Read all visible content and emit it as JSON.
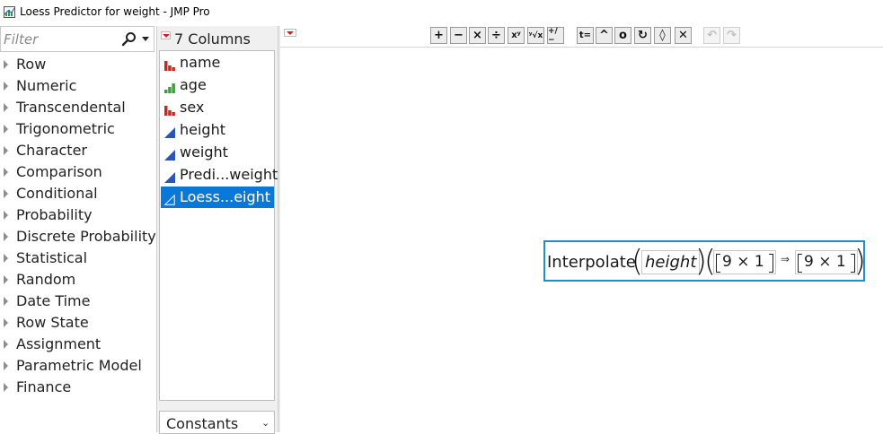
{
  "window": {
    "title": "Loess Predictor for weight - JMP Pro"
  },
  "functions_panel": {
    "filter_placeholder": "Filter",
    "categories": [
      "Row",
      "Numeric",
      "Transcendental",
      "Trigonometric",
      "Character",
      "Comparison",
      "Conditional",
      "Probability",
      "Discrete Probability",
      "Statistical",
      "Random",
      "Date Time",
      "Row State",
      "Assignment",
      "Parametric Model",
      "Finance"
    ]
  },
  "columns_panel": {
    "header": "7 Columns",
    "columns": [
      {
        "name": "name",
        "icon": "nominal-icon",
        "color": "#c8281e"
      },
      {
        "name": "age",
        "icon": "ordinal-icon",
        "color": "#3f9e3f"
      },
      {
        "name": "sex",
        "icon": "nominal-icon",
        "color": "#c8281e"
      },
      {
        "name": "height",
        "icon": "continuous-icon",
        "color": "#2a56b8"
      },
      {
        "name": "weight",
        "icon": "continuous-icon",
        "color": "#2a56b8"
      },
      {
        "name": "Predi...weight",
        "icon": "continuous-icon",
        "color": "#2a56b8"
      },
      {
        "name": "Loess...eight",
        "icon": "continuous-icon",
        "color": "#ffffff",
        "selected": true
      }
    ],
    "constants_label": "Constants"
  },
  "toolbar": {
    "buttons": [
      {
        "name": "add-button",
        "glyph": "+"
      },
      {
        "name": "subtract-button",
        "glyph": "−"
      },
      {
        "name": "multiply-button",
        "glyph": "×"
      },
      {
        "name": "divide-button",
        "glyph": "÷"
      },
      {
        "name": "power-button",
        "glyph": "xʸ"
      },
      {
        "name": "root-button",
        "glyph": "ʸ√x"
      },
      {
        "name": "negate-button",
        "glyph": "+/−"
      },
      {
        "name": "assign-button",
        "glyph": "t="
      },
      {
        "name": "peel-button",
        "glyph": "^"
      },
      {
        "name": "local-variable-button",
        "glyph": "o"
      },
      {
        "name": "swap-button",
        "glyph": "↻"
      },
      {
        "name": "unthrow-button",
        "glyph": "◊"
      },
      {
        "name": "delete-button",
        "glyph": "✕"
      },
      {
        "name": "undo-button",
        "glyph": "↶",
        "disabled": true
      },
      {
        "name": "redo-button",
        "glyph": "↷",
        "disabled": true
      }
    ]
  },
  "formula": {
    "function": "Interpolate",
    "argument": "height",
    "matrix_1": "9 × 1",
    "arrow": "⇒",
    "matrix_2": "9 × 1"
  }
}
